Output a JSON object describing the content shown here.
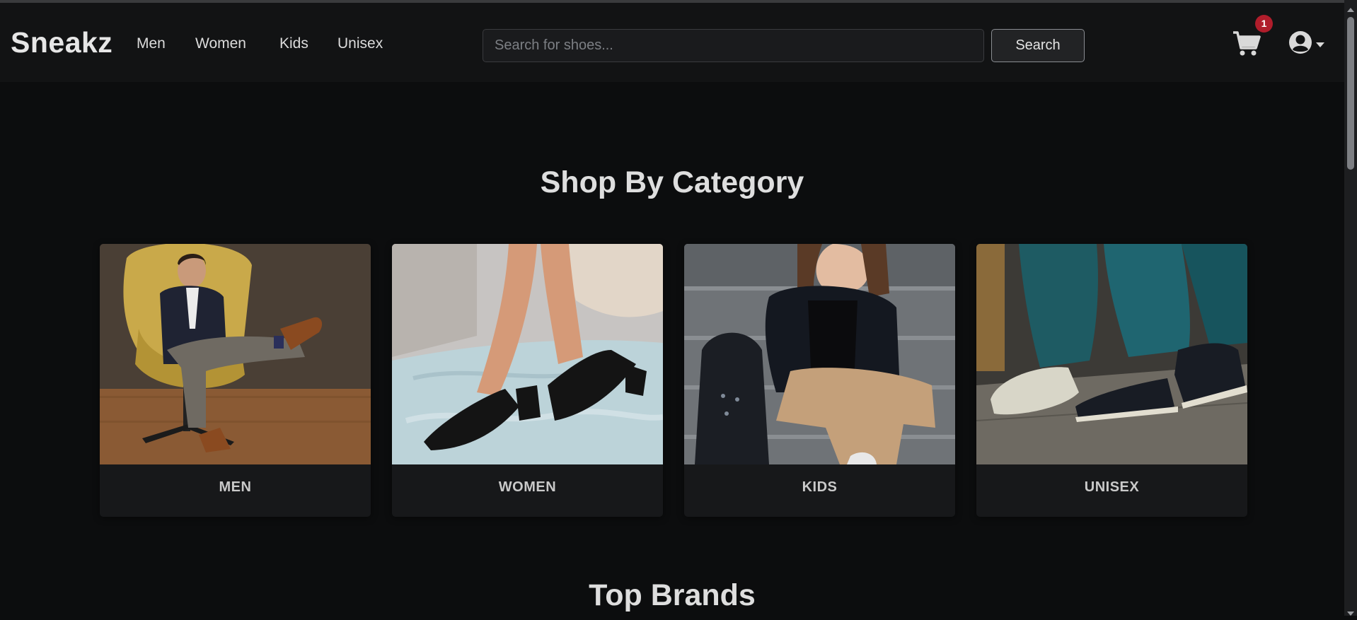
{
  "header": {
    "brand": "Sneakz",
    "nav": [
      "Men",
      "Women",
      "Kids",
      "Unisex"
    ],
    "search": {
      "placeholder": "Search for shoes...",
      "value": "",
      "button_label": "Search"
    },
    "cart": {
      "icon": "cart-icon",
      "count": "1",
      "badge_color": "#b01d2b"
    },
    "account": {
      "icon": "user-circle-icon"
    }
  },
  "categories_section": {
    "title": "Shop By Category",
    "cards": [
      {
        "label": "MEN"
      },
      {
        "label": "WOMEN"
      },
      {
        "label": "KIDS"
      },
      {
        "label": "UNISEX"
      }
    ]
  },
  "brands_section": {
    "title": "Top Brands"
  },
  "colors": {
    "background": "#0c0d0e",
    "navbar": "#121314",
    "card": "#17181a",
    "badge": "#b01d2b"
  }
}
